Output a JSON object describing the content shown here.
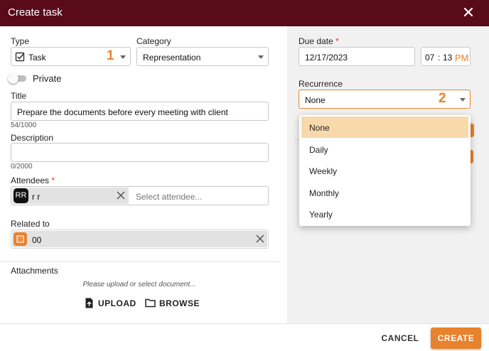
{
  "dialog": {
    "title": "Create task"
  },
  "type": {
    "label": "Type",
    "value": "Task",
    "step": "1"
  },
  "category": {
    "label": "Category",
    "value": "Representation"
  },
  "private": {
    "label": "Private",
    "on": false
  },
  "title_field": {
    "label": "Title",
    "value": "Prepare the documents before every meeting with client",
    "counter": "54/1000"
  },
  "description": {
    "label": "Description",
    "value": "",
    "counter": "0/2000"
  },
  "attendees": {
    "label": "Attendees",
    "required_mark": "*",
    "chip_initials": "RR",
    "chip_name": "r r",
    "placeholder": "Select attendee..."
  },
  "related": {
    "label": "Related to",
    "chip_value": "00"
  },
  "attachments": {
    "label": "Attachments",
    "hint": "Please upload or select document...",
    "upload_label": "UPLOAD",
    "browse_label": "BROWSE"
  },
  "due_date": {
    "label": "Due date",
    "required_mark": "*",
    "date": "12/17/2023",
    "hour": "07",
    "sep": ":",
    "minute": "13",
    "ampm": "PM"
  },
  "recurrence": {
    "label": "Recurrence",
    "value": "None",
    "step": "2",
    "options": [
      "None",
      "Daily",
      "Weekly",
      "Monthly",
      "Yearly"
    ],
    "selected": "None"
  },
  "footer": {
    "cancel_label": "CANCEL",
    "create_label": "CREATE"
  },
  "colors": {
    "header": "#5a0b1a",
    "accent": "#e8822d",
    "selected_option": "#f8d9ab",
    "panel": "#f1f1f1"
  }
}
